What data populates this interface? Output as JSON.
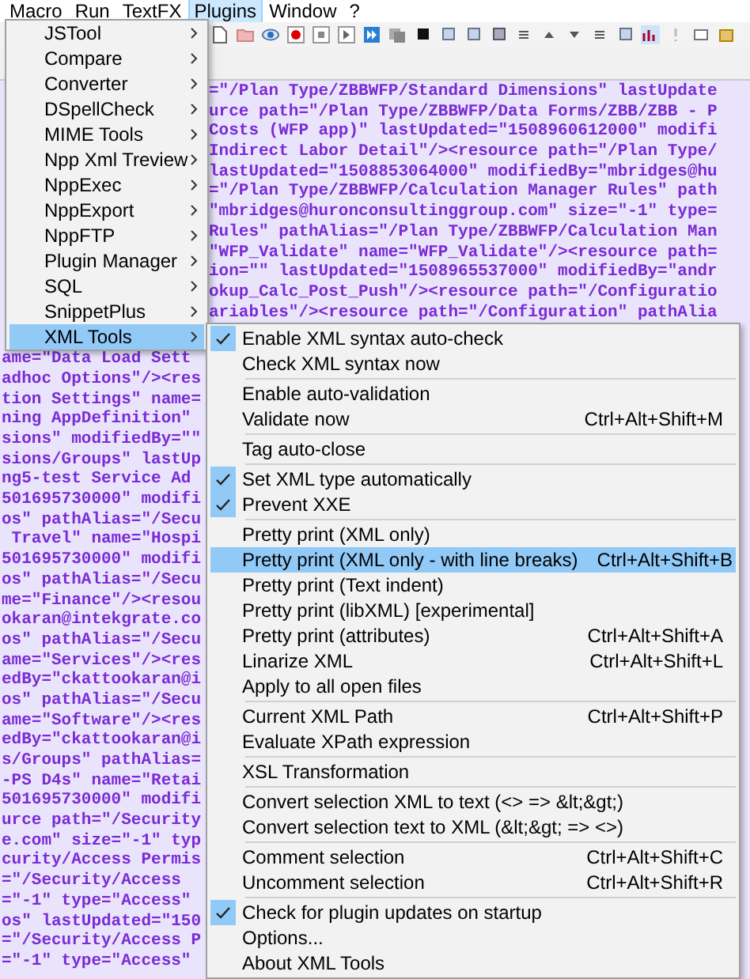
{
  "menu_bar": [
    {
      "label": "Macro",
      "selected": false
    },
    {
      "label": "Run",
      "selected": false
    },
    {
      "label": "TextFX",
      "selected": false
    },
    {
      "label": "Plugins",
      "selected": true
    },
    {
      "label": "Window",
      "selected": false
    },
    {
      "label": "?",
      "selected": false
    }
  ],
  "editor": {
    "upper_lines": [
      "=\"/Plan Type/ZBBWFP/Standard Dimensions\" lastUpdate",
      "urce path=\"/Plan Type/ZBBWFP/Data Forms/ZBB/ZBB - P",
      "Costs (WFP app)\" lastUpdated=\"1508960612000\" modifi",
      "Indirect Labor Detail\"/><resource path=\"/Plan Type/",
      "lastUpdated=\"1508853064000\" modifiedBy=\"mbridges@hu",
      "=\"/Plan Type/ZBBWFP/Calculation Manager Rules\" path",
      "\"mbridges@huronconsultinggroup.com\" size=\"-1\" type=",
      "Rules\" pathAlias=\"/Plan Type/ZBBWFP/Calculation Man",
      "\"WFP_Validate\" name=\"WFP_Validate\"/><resource path=",
      "ion=\"\" lastUpdated=\"1508965537000\" modifiedBy=\"andr",
      "okup_Calc_Post_Push\"/><resource path=\"/Configuratio",
      "ariables\"/><resource path=\"/Configuration\" pathAlia"
    ],
    "lower_lines": [
      "ame=\"Data Load Sett",
      "adhoc Options\"/><res",
      "tion Settings\" name=",
      "ning AppDefinition\"",
      "sions\" modifiedBy=\"\"",
      "sions/Groups\" lastUp",
      "ng5-test Service Ad",
      "501695730000\" modifi",
      "os\" pathAlias=\"/Secu",
      " Travel\" name=\"Hospi",
      "501695730000\" modifi",
      "os\" pathAlias=\"/Secu",
      "me=\"Finance\"/><resou",
      "okaran@intekgrate.co",
      "os\" pathAlias=\"/Secu",
      "ame=\"Services\"/><res",
      "edBy=\"ckattookaran@i",
      "os\" pathAlias=\"/Secu",
      "ame=\"Software\"/><res",
      "edBy=\"ckattookaran@i",
      "s/Groups\" pathAlias=",
      "-PS D4s\" name=\"Retai",
      "501695730000\" modifi",
      "urce path=\"/Security",
      "e.com\" size=\"-1\" typ",
      "curity/Access Permis",
      "=\"/Security/Access",
      "=\"-1\" type=\"Access\"",
      "os\" lastUpdated=\"150",
      "=\"/Security/Access P",
      "=\"-1\" type=\"Access\""
    ]
  },
  "plugins_menu": {
    "items": [
      {
        "label": "JSTool",
        "selected": false
      },
      {
        "label": "Compare",
        "selected": false
      },
      {
        "label": "Converter",
        "selected": false
      },
      {
        "label": "DSpellCheck",
        "selected": false
      },
      {
        "label": "MIME Tools",
        "selected": false
      },
      {
        "label": "Npp Xml Treview",
        "selected": false
      },
      {
        "label": "NppExec",
        "selected": false
      },
      {
        "label": "NppExport",
        "selected": false
      },
      {
        "label": "NppFTP",
        "selected": false
      },
      {
        "label": "Plugin Manager",
        "selected": false
      },
      {
        "label": "SQL",
        "selected": false
      },
      {
        "label": "SnippetPlus",
        "selected": false
      },
      {
        "label": "XML Tools",
        "selected": true
      }
    ]
  },
  "xml_tools_menu": {
    "items": [
      {
        "kind": "item",
        "label": "Enable XML syntax auto-check",
        "checked": true,
        "selected": false
      },
      {
        "kind": "item",
        "label": "Check XML syntax now",
        "checked": false,
        "selected": false
      },
      {
        "kind": "separator"
      },
      {
        "kind": "item",
        "label": "Enable auto-validation",
        "checked": false,
        "selected": false
      },
      {
        "kind": "item",
        "label": "Validate now",
        "shortcut": "Ctrl+Alt+Shift+M",
        "checked": false,
        "selected": false
      },
      {
        "kind": "separator"
      },
      {
        "kind": "item",
        "label": "Tag auto-close",
        "checked": false,
        "selected": false
      },
      {
        "kind": "separator"
      },
      {
        "kind": "item",
        "label": "Set XML type automatically",
        "checked": true,
        "selected": false
      },
      {
        "kind": "item",
        "label": "Prevent XXE",
        "checked": true,
        "selected": false
      },
      {
        "kind": "separator"
      },
      {
        "kind": "item",
        "label": "Pretty print (XML only)",
        "checked": false,
        "selected": false
      },
      {
        "kind": "item",
        "label": "Pretty print (XML only - with line breaks)",
        "shortcut": "Ctrl+Alt+Shift+B",
        "checked": false,
        "selected": true
      },
      {
        "kind": "item",
        "label": "Pretty print (Text indent)",
        "checked": false,
        "selected": false
      },
      {
        "kind": "item",
        "label": "Pretty print (libXML) [experimental]",
        "checked": false,
        "selected": false
      },
      {
        "kind": "item",
        "label": "Pretty print (attributes)",
        "shortcut": "Ctrl+Alt+Shift+A",
        "checked": false,
        "selected": false
      },
      {
        "kind": "item",
        "label": "Linarize XML",
        "shortcut": "Ctrl+Alt+Shift+L",
        "checked": false,
        "selected": false
      },
      {
        "kind": "item",
        "label": "Apply to all open files",
        "checked": false,
        "selected": false
      },
      {
        "kind": "separator"
      },
      {
        "kind": "item",
        "label": "Current XML Path",
        "shortcut": "Ctrl+Alt+Shift+P",
        "checked": false,
        "selected": false
      },
      {
        "kind": "item",
        "label": "Evaluate XPath expression",
        "checked": false,
        "selected": false
      },
      {
        "kind": "separator"
      },
      {
        "kind": "item",
        "label": "XSL Transformation",
        "checked": false,
        "selected": false
      },
      {
        "kind": "separator"
      },
      {
        "kind": "item",
        "label": "Convert selection XML to text (<> => &lt;&gt;)",
        "checked": false,
        "selected": false
      },
      {
        "kind": "item",
        "label": "Convert selection text to XML (&lt;&gt; => <>)",
        "checked": false,
        "selected": false
      },
      {
        "kind": "separator"
      },
      {
        "kind": "item",
        "label": "Comment selection",
        "shortcut": "Ctrl+Alt+Shift+C",
        "checked": false,
        "selected": false
      },
      {
        "kind": "item",
        "label": "Uncomment selection",
        "shortcut": "Ctrl+Alt+Shift+R",
        "checked": false,
        "selected": false
      },
      {
        "kind": "separator"
      },
      {
        "kind": "item",
        "label": "Check for plugin updates on startup",
        "checked": true,
        "selected": false
      },
      {
        "kind": "item",
        "label": "Options...",
        "checked": false,
        "selected": false
      },
      {
        "kind": "item",
        "label": "About XML Tools",
        "checked": false,
        "selected": false
      }
    ]
  }
}
